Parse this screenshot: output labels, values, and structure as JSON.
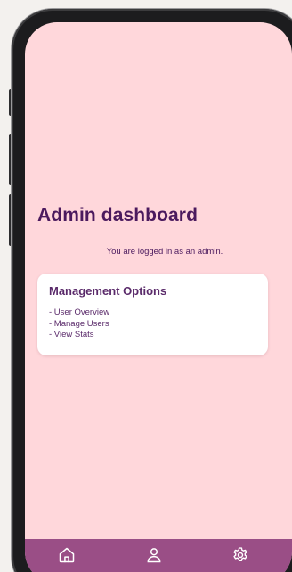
{
  "screen": {
    "title": "Admin dashboard",
    "subtitle": "You are logged in as an admin."
  },
  "management_card": {
    "title": "Management Options",
    "items": [
      "- User Overview",
      "- Manage Users",
      "- View Stats"
    ]
  },
  "bottom_nav": {
    "items": [
      {
        "icon": "home-icon"
      },
      {
        "icon": "user-icon"
      },
      {
        "icon": "gear-icon"
      }
    ]
  },
  "colors": {
    "screen_background": "#ffd7db",
    "nav_background": "#9a4e86",
    "title_text": "#4b1a5e",
    "card_background": "#ffffff",
    "phone_frame": "#1c1c1e"
  }
}
